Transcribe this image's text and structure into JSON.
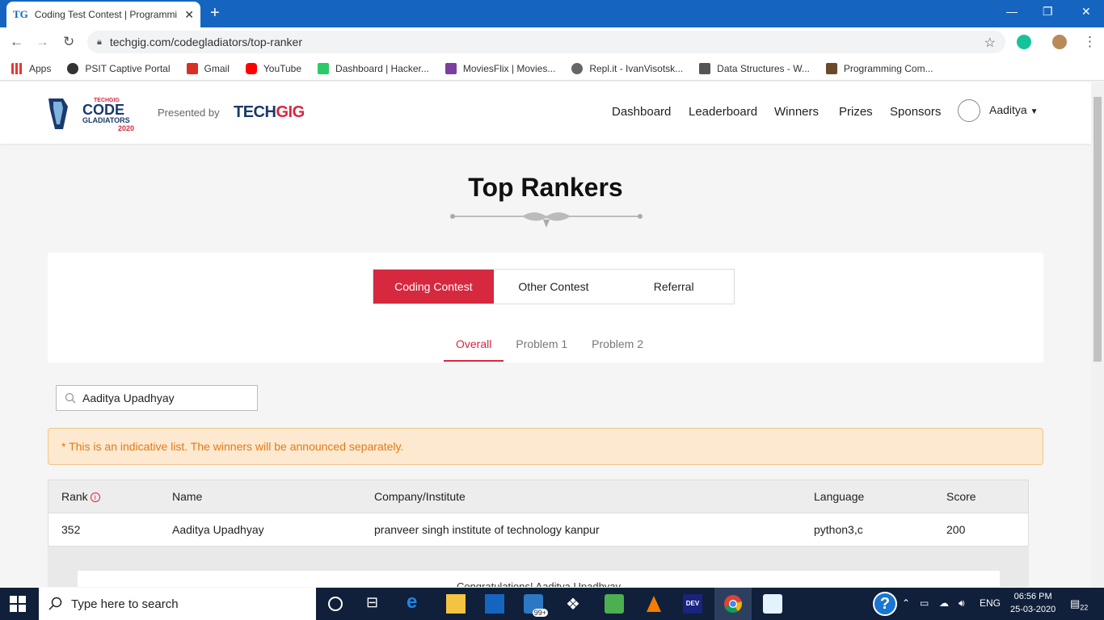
{
  "browser": {
    "tab_title": "Coding Test Contest | Programmi",
    "tab_favicon": "TG",
    "url": "techgig.com/codegladiators/top-ranker",
    "bookmarks": [
      "Apps",
      "PSIT Captive Portal",
      "Gmail",
      "YouTube",
      "Dashboard | Hacker...",
      "MoviesFlix | Movies...",
      "Repl.it - IvanVisotsk...",
      "Data Structures - W...",
      "Programming Com..."
    ]
  },
  "header": {
    "logo_top": "TECHGIG",
    "logo_main": "CODE",
    "logo_sub": "GLADIATORS",
    "logo_year": "2020",
    "presented_by": "Presented by",
    "brand_a": "TECH",
    "brand_b": "GIG",
    "nav": [
      "Dashboard",
      "Leaderboard",
      "Winners",
      "Prizes",
      "Sponsors"
    ],
    "user": "Aaditya"
  },
  "main": {
    "title": "Top Rankers",
    "tabs": [
      "Coding Contest",
      "Other Contest",
      "Referral"
    ],
    "subtabs": [
      "Overall",
      "Problem 1",
      "Problem 2"
    ],
    "search_value": "Aaditya Upadhyay",
    "alert": "* This is an indicative list. The winners will be announced separately.",
    "table": {
      "headers": [
        "Rank",
        "Name",
        "Company/Institute",
        "Language",
        "Score"
      ],
      "row": [
        "352",
        "Aaditya Upadhyay",
        "pranveer singh institute of technology kanpur",
        "python3,c",
        "200"
      ]
    },
    "popup_text": "Congratulations! Aaditya Upadhyay"
  },
  "taskbar": {
    "search_placeholder": "Type here to search",
    "store_badge": "99+",
    "language": "ENG",
    "time": "06:56 PM",
    "date": "25-03-2020",
    "notifications": "22"
  },
  "colors": {
    "accent": "#d6283f",
    "browser": "#1565c0",
    "alert_text": "#e17a1b",
    "taskbar": "#101f3a"
  }
}
